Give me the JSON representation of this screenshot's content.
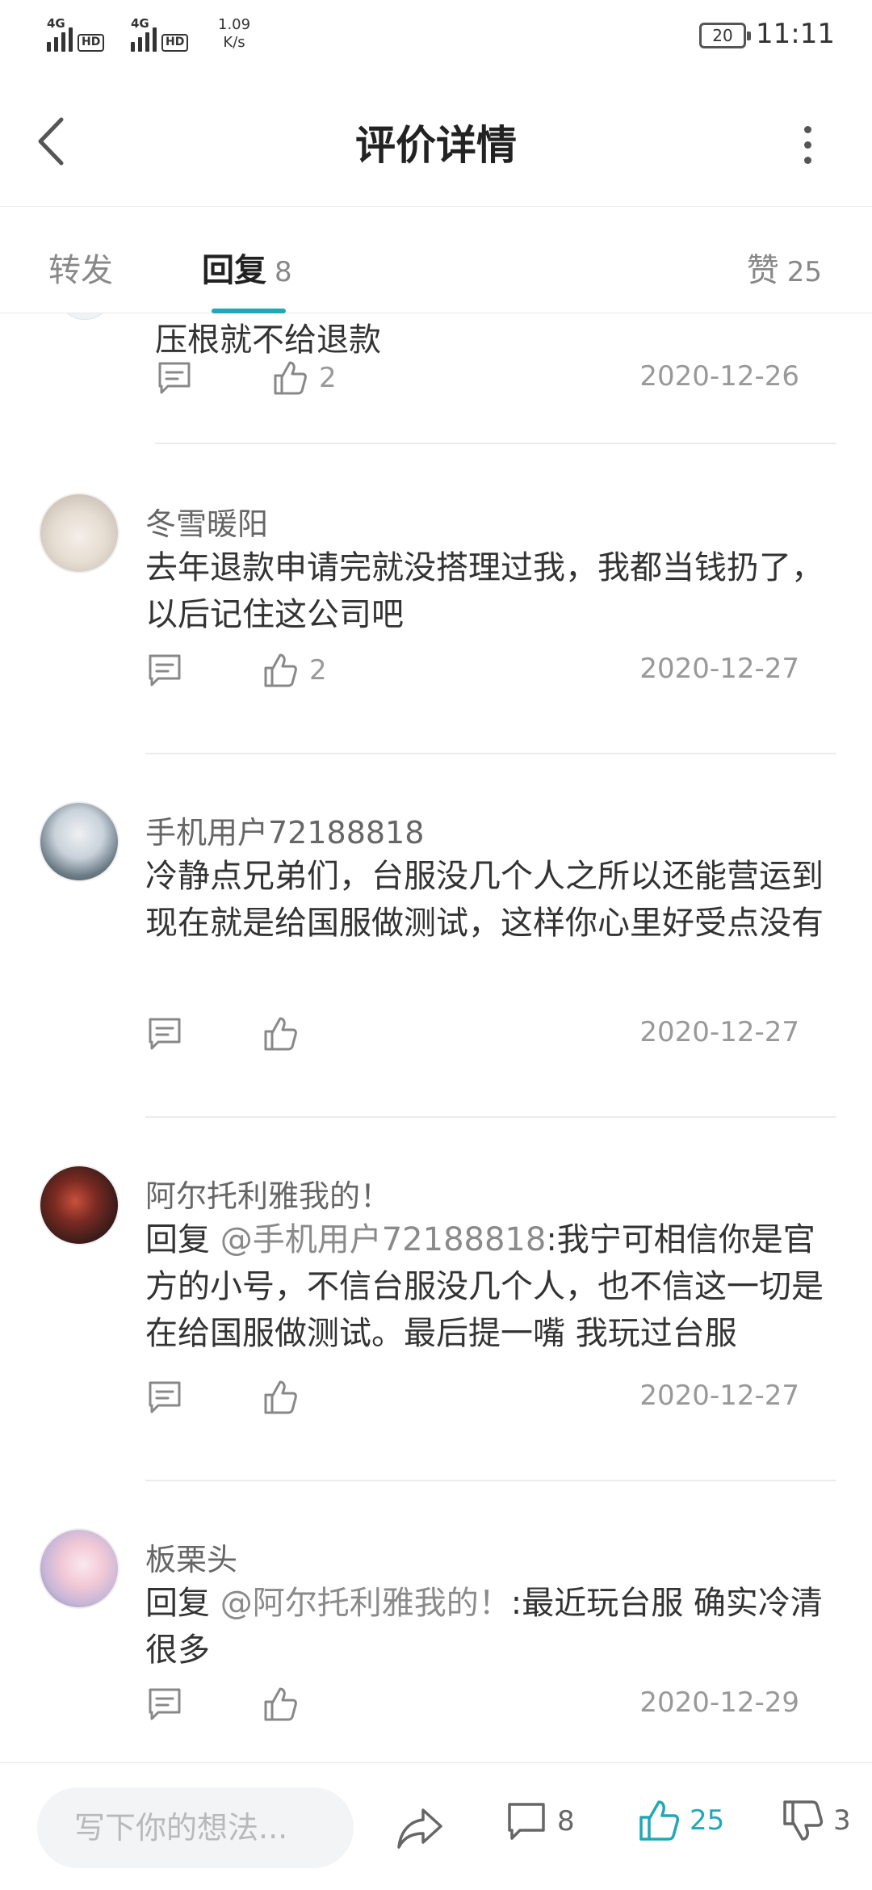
{
  "status_bar": {
    "network_1": "4G",
    "network_2": "4G",
    "hd_label": "HD",
    "speed_value": "1.09",
    "speed_unit": "K/s",
    "battery": "20",
    "time": "11:11"
  },
  "header": {
    "title": "评价详情"
  },
  "tabs": {
    "forward_label": "转发",
    "reply_label": "回复",
    "reply_count": "8",
    "like_label": "赞",
    "like_count": "25"
  },
  "partial_comment": {
    "text": "压根就不给退款",
    "like_count": "2",
    "date": "2020-12-26"
  },
  "comments": [
    {
      "username": "冬雪暖阳",
      "text": "去年退款申请完就没搭理过我，我都当钱扔了，以后记住这公司吧",
      "like_count": "2",
      "date": "2020-12-27"
    },
    {
      "username": "手机用户72188818",
      "text": "冷静点兄弟们，台服没几个人之所以还能营运到现在就是给国服做测试，这样你心里好受点没有",
      "like_count": "",
      "date": "2020-12-27"
    },
    {
      "username": "阿尔托利雅我的！",
      "reply_prefix": " 回复 ",
      "mention": "@手机用户72188818",
      "text": ":我宁可相信你是官方的小号，不信台服没几个人，也不信这一切是在给国服做测试。最后提一嘴 我玩过台服",
      "like_count": "",
      "date": "2020-12-27"
    },
    {
      "username": "板栗头",
      "reply_prefix": " 回复 ",
      "mention": "@阿尔托利雅我的！",
      "text": ":最近玩台服 确实冷清很多",
      "like_count": "",
      "date": "2020-12-29"
    }
  ],
  "bottom_bar": {
    "input_placeholder": "写下你的想法...",
    "comment_count": "8",
    "like_count": "25",
    "dislike_count": "3"
  },
  "colors": {
    "accent": "#20a8b8",
    "muted": "#999999"
  }
}
